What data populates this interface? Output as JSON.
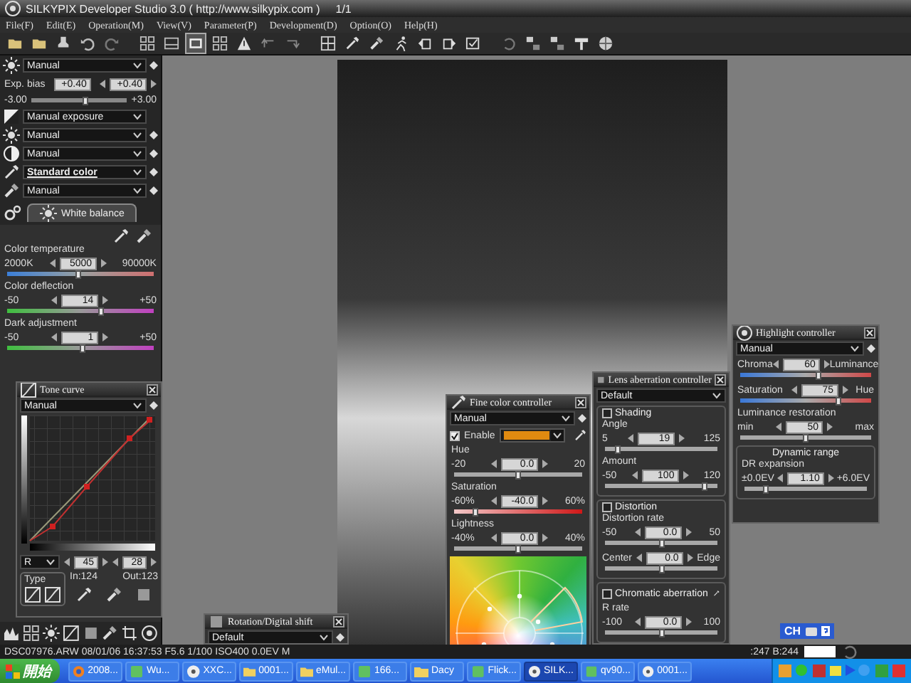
{
  "window": {
    "title": "SILKYPIX Developer Studio 3.0 ( http://www.silkypix.com )",
    "page": "1/1"
  },
  "menu": [
    "File(F)",
    "Edit(E)",
    "Operation(M)",
    "View(V)",
    "Parameter(P)",
    "Development(D)",
    "Option(O)",
    "Help(H)"
  ],
  "toolbar": [
    {
      "selected": false
    },
    {
      "selected": false
    },
    {
      "selected": false
    },
    {
      "selected": false
    },
    {
      "selected": false
    },
    {
      "selected": false
    },
    {
      "selected": false
    },
    {
      "selected": true
    },
    {
      "selected": false
    },
    {
      "selected": false
    },
    {
      "selected": false
    },
    {
      "selected": false
    },
    {
      "selected": false
    },
    {
      "selected": false
    },
    {
      "selected": false
    },
    {
      "selected": false
    },
    {
      "selected": false
    },
    {
      "selected": false
    },
    {
      "selected": false
    },
    {
      "selected": false
    },
    {
      "selected": false
    },
    {
      "selected": false
    },
    {
      "selected": false
    },
    {
      "selected": false
    }
  ],
  "left_panel": {
    "preset": "Manual",
    "exposure": {
      "label": "Exp. bias",
      "value": "+0.40",
      "step_value": "+0.40",
      "min": "-3.00",
      "max": "+3.00",
      "level": 0.57
    },
    "dropdowns": [
      {
        "value": "Manual exposure",
        "bold": false,
        "dot": false
      },
      {
        "value": "Manual",
        "bold": false,
        "dot": true
      },
      {
        "value": "Manual",
        "bold": false,
        "dot": true
      },
      {
        "value": "Standard color",
        "bold": true,
        "dot": true
      },
      {
        "value": "Manual",
        "bold": false,
        "dot": true
      }
    ],
    "tab": {
      "label": "White balance",
      "selected": true
    },
    "sliders": [
      {
        "label": "Color temperature",
        "min": "2000K",
        "value": "5000",
        "max": "90000K",
        "level": 0.49,
        "kind": "temperature"
      },
      {
        "label": "Color deflection",
        "min": "-50",
        "value": "14",
        "max": "+50",
        "level": 0.64,
        "kind": "tint"
      },
      {
        "label": "Dark adjustment",
        "min": "-50",
        "value": "1",
        "max": "+50",
        "level": 0.51,
        "kind": "tint"
      }
    ]
  },
  "tone_curve": {
    "title": "Tone curve",
    "preset": "Manual",
    "channel": "R",
    "input": "45",
    "output": "28",
    "type_label": "Type",
    "in_reading": "In:124",
    "out_reading": "Out:123"
  },
  "rotation": {
    "title": "Rotation/Digital shift",
    "preset": "Default"
  },
  "fine_color": {
    "title": "Fine color controller",
    "preset": "Manual",
    "enable": {
      "label": "Enable",
      "checked": true
    },
    "sliders": [
      {
        "label": "Hue",
        "min": "-20",
        "value": "0.0",
        "max": "20",
        "level": 0.5,
        "kind": "plain"
      },
      {
        "label": "Saturation",
        "min": "-60%",
        "value": "-40.0",
        "max": "60%",
        "level": 0.17,
        "kind": "red"
      },
      {
        "label": "Lightness",
        "min": "-40%",
        "value": "0.0",
        "max": "40%",
        "level": 0.5,
        "kind": "plain"
      }
    ]
  },
  "lens": {
    "title": "Lens aberration controller",
    "preset": "Default",
    "groups": [
      {
        "label": "Shading",
        "checked": false,
        "sliders": [
          {
            "label": "Angle",
            "min": "5",
            "value": "19",
            "max": "125",
            "level": 0.12,
            "kind": "plain"
          },
          {
            "label": "Amount",
            "min": "-50",
            "value": "100",
            "max": "120",
            "level": 0.88,
            "kind": "plain"
          }
        ]
      },
      {
        "label": "Distortion",
        "checked": false,
        "sliders": [
          {
            "label": "Distortion rate",
            "min": "-50",
            "value": "0.0",
            "max": "50",
            "level": 0.5,
            "kind": "plain"
          },
          {
            "min": "Center",
            "value": "0.0",
            "max": "Edge",
            "level": 0.5,
            "kind": "plain"
          }
        ]
      },
      {
        "label": "Chromatic aberration",
        "checked": false,
        "sliders": [
          {
            "label": "R rate",
            "min": "-100",
            "value": "0.0",
            "max": "100",
            "level": 0.5,
            "kind": "plain"
          }
        ]
      }
    ]
  },
  "highlight": {
    "title": "Highlight controller",
    "preset": "Manual",
    "sliders": [
      {
        "min": "Chroma",
        "value": "60",
        "max": "Luminance",
        "level": 0.6,
        "kind": "blue-red"
      },
      {
        "min": "Saturation",
        "value": "75",
        "max": "Hue",
        "level": 0.75,
        "kind": "blue-red"
      },
      {
        "label": "Luminance restoration",
        "min": "min",
        "value": "50",
        "max": "max",
        "level": 0.5,
        "kind": "plain"
      }
    ],
    "group": {
      "label": "Dynamic range",
      "sliders": [
        {
          "label": "DR expansion",
          "min": "±0.0EV",
          "value": "1.10",
          "max": "+6.0EV",
          "level": 0.18,
          "kind": "plain"
        }
      ]
    }
  },
  "language_bar": {
    "label": "CH"
  },
  "status_bar": {
    "file_info": "DSC07976.ARW 08/01/06 16:37:53 F5.6 1/100 ISO400 0.0EV M",
    "rgb": ":247 B:244"
  },
  "taskbar": {
    "start": "開始",
    "items": [
      {
        "label": "2008...",
        "kind": "browser",
        "selected": false
      },
      {
        "label": "Wu...",
        "kind": "app",
        "selected": false
      },
      {
        "label": "XXC...",
        "kind": "disk",
        "selected": false
      },
      {
        "label": "0001...",
        "kind": "folder",
        "selected": false
      },
      {
        "label": "eMul...",
        "kind": "folder",
        "selected": false
      },
      {
        "label": "166...",
        "kind": "app",
        "selected": false
      },
      {
        "label": "Dacy",
        "kind": "folder",
        "selected": false
      },
      {
        "label": "Flick...",
        "kind": "app",
        "selected": false
      },
      {
        "label": "SILK...",
        "kind": "disk",
        "selected": true
      },
      {
        "label": "qv90...",
        "kind": "app",
        "selected": false
      },
      {
        "label": "0001...",
        "kind": "disk",
        "selected": false
      }
    ]
  }
}
